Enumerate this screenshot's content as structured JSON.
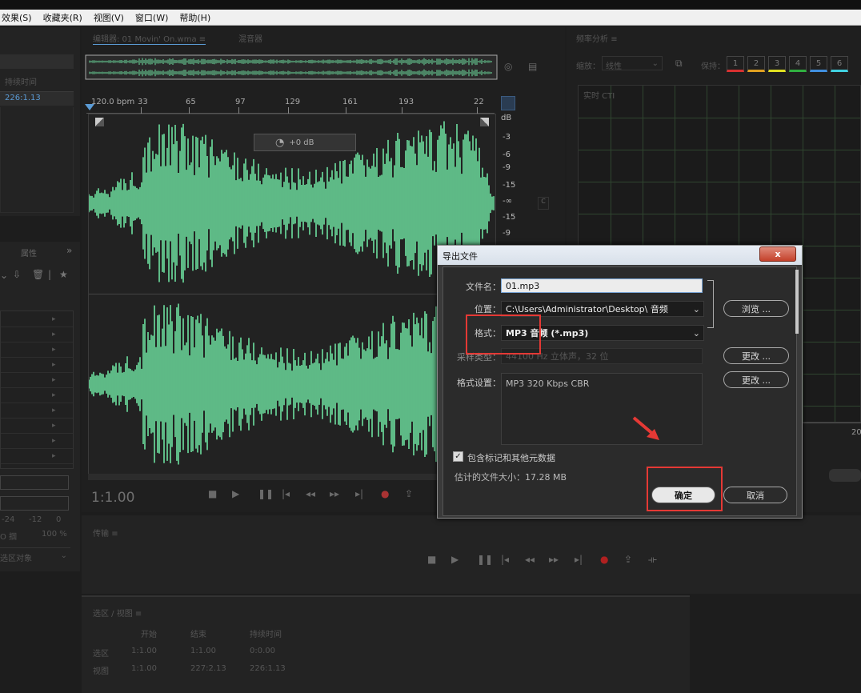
{
  "menu": [
    {
      "label": "效果(S)"
    },
    {
      "label": "收藏夹(R)"
    },
    {
      "label": "视图(V)"
    },
    {
      "label": "窗口(W)"
    },
    {
      "label": "帮助(H)"
    }
  ],
  "left": {
    "duration_header": "持续时间",
    "duration_value": "226:1.13",
    "properties_tab": "属性",
    "collapse": "»",
    "meter_ticks": [
      "-24",
      "-12",
      "0"
    ],
    "zoom_percent": "100 %",
    "auto_label": "O 掴",
    "selection_obj": "选区对象"
  },
  "editor": {
    "tab": "编辑器: 01 Movin' On.wma",
    "tab_menu": "≡",
    "mixer_tab": "混音器",
    "bpm": "120.0 bpm",
    "beats": [
      "33",
      "65",
      "97",
      "129",
      "161",
      "193",
      "22"
    ],
    "db_scale": [
      "dB",
      "-3",
      "-6",
      "-9",
      "-15",
      "-∞",
      "-15",
      "-9"
    ],
    "gain": "+0 dB",
    "time": "1:1.00"
  },
  "freq": {
    "title": "频率分析",
    "menu": "≡",
    "scale_label": "缩放：",
    "scale_value": "线性",
    "hold_label": "保持：",
    "holds": [
      "1",
      "2",
      "3",
      "4",
      "5",
      "6"
    ],
    "hold_colors": [
      "#d83030",
      "#e0a020",
      "#e0e020",
      "#30b040",
      "#4090e0",
      "#40d0e0"
    ],
    "cti": "实时 CTI",
    "axis_value": "20"
  },
  "transport": {
    "title": "传输",
    "menu": "≡"
  },
  "selview": {
    "title": "选区 / 视图",
    "menu": "≡",
    "headers": [
      "开始",
      "结束",
      "持续时间"
    ],
    "rows": [
      {
        "label": "选区",
        "start": "1:1.00",
        "end": "1:1.00",
        "duration": "0:0.00"
      },
      {
        "label": "视图",
        "start": "1:1.00",
        "end": "227:2.13",
        "duration": "226:1.13"
      }
    ]
  },
  "dialog": {
    "title": "导出文件",
    "close": "x",
    "filename_label": "文件名：",
    "filename_value": "01.mp3",
    "location_label": "位置：",
    "location_value": "C:\\Users\\Administrator\\Desktop\\ 音频",
    "browse_btn": "浏览 ...",
    "format_label": "格式：",
    "format_value": "MP3 音频 (*.mp3)",
    "sample_label": "采样类型：",
    "sample_value": "44100 Hz 立体声，32 位",
    "change_btn_1": "更改 ...",
    "format_settings_label": "格式设置：",
    "format_settings_value": "MP3 320 Kbps CBR",
    "change_btn_2": "更改 ...",
    "include_markers": "包含标记和其他元数据",
    "estimated_size": "估计的文件大小：17.28 MB",
    "ok_btn": "确定",
    "cancel_btn": "取消"
  },
  "colors": {
    "wave": "#6ee0a0",
    "highlight": "#e53935",
    "accent": "#5b9bd5"
  }
}
